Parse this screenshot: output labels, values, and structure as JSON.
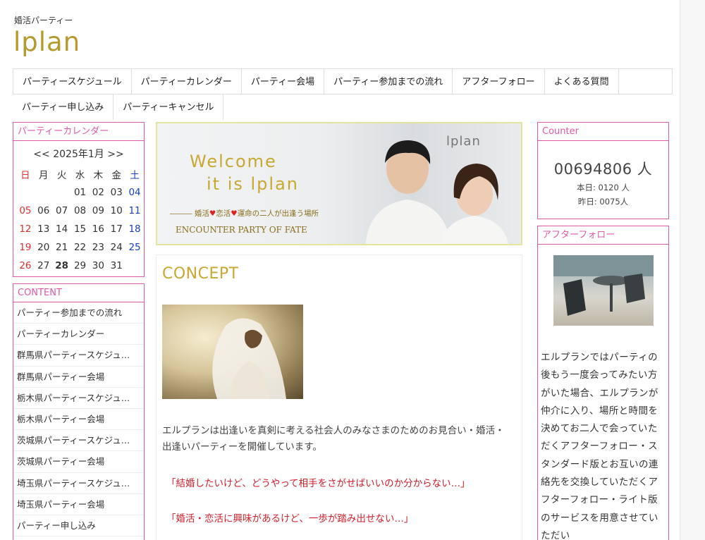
{
  "header": {
    "tagline": "婚活パーティー",
    "logo": "lplan"
  },
  "nav": {
    "row1": [
      "パーティースケジュール",
      "パーティーカレンダー",
      "パーティー会場",
      "パーティー参加までの流れ",
      "アフターフォロー",
      "よくある質問"
    ],
    "row2": [
      "パーティー申し込み",
      "パーティーキャンセル"
    ]
  },
  "calendar": {
    "title": "パーティーカレンダー",
    "prev": "<<",
    "month_label": "2025年1月",
    "next": ">>",
    "weekdays": [
      "日",
      "月",
      "火",
      "水",
      "木",
      "金",
      "土"
    ],
    "weeks": [
      [
        "",
        "",
        "",
        "01",
        "02",
        "03",
        "04"
      ],
      [
        "05",
        "06",
        "07",
        "08",
        "09",
        "10",
        "11"
      ],
      [
        "12",
        "13",
        "14",
        "15",
        "16",
        "17",
        "18"
      ],
      [
        "19",
        "20",
        "21",
        "22",
        "23",
        "24",
        "25"
      ],
      [
        "26",
        "27",
        "28",
        "29",
        "30",
        "31",
        ""
      ]
    ],
    "today": "28",
    "colors": {
      "sunday": "#e0302e",
      "saturday": "#1a3fc4",
      "accent": "#e05aa8"
    }
  },
  "content_menu": {
    "title": "CONTENT",
    "items": [
      "パーティー参加までの流れ",
      "パーティーカレンダー",
      "群馬県パーティースケジュ…",
      "群馬県パーティー会場",
      "栃木県パーティースケジュ…",
      "栃木県パーティー会場",
      "茨城県パーティースケジュ…",
      "茨城県パーティー会場",
      "埼玉県パーティースケジュ…",
      "埼玉県パーティー会場",
      "パーティー申し込み"
    ]
  },
  "banner": {
    "welcome_line1": "Welcome",
    "welcome_line2": "it is lplan",
    "line_prefix": "――― 婚活",
    "line_mid1": "恋活",
    "line_suffix": "運命の二人が出逢う場所",
    "subtitle": "ENCOUNTER PARTY OF FATE",
    "logo": "lplan"
  },
  "concept": {
    "title": "CONCEPT",
    "text": "エルプランは出逢いを真剣に考える社会人のみなさまのためのお見合い・婚活・出逢いパーティーを開催しています。",
    "quote1": "「結婚したいけど、どうやって相手をさがせばいいのか分からない…」",
    "quote2": "「婚活・恋活に興味があるけど、一歩が踏み出せない…」"
  },
  "counter": {
    "title": "Counter",
    "total": "00694806 人",
    "today": "本日: 0120 人",
    "yesterday": "昨日: 0075人"
  },
  "after_follow": {
    "title": "アフターフォロー",
    "text": "エルプランではパーティの後もう一度会ってみたい方がいた場合、エルプランが仲介に入り、場所と時間を決めてお二人で会っていただくアフターフォロー・スタンダード版とお互いの連絡先を交換していただくアフターフォロー・ライト版のサービスを用意させていただい"
  },
  "theme": {
    "gold": "#b59a2e",
    "pink": "#e05aa8",
    "red_text": "#d0202a"
  }
}
